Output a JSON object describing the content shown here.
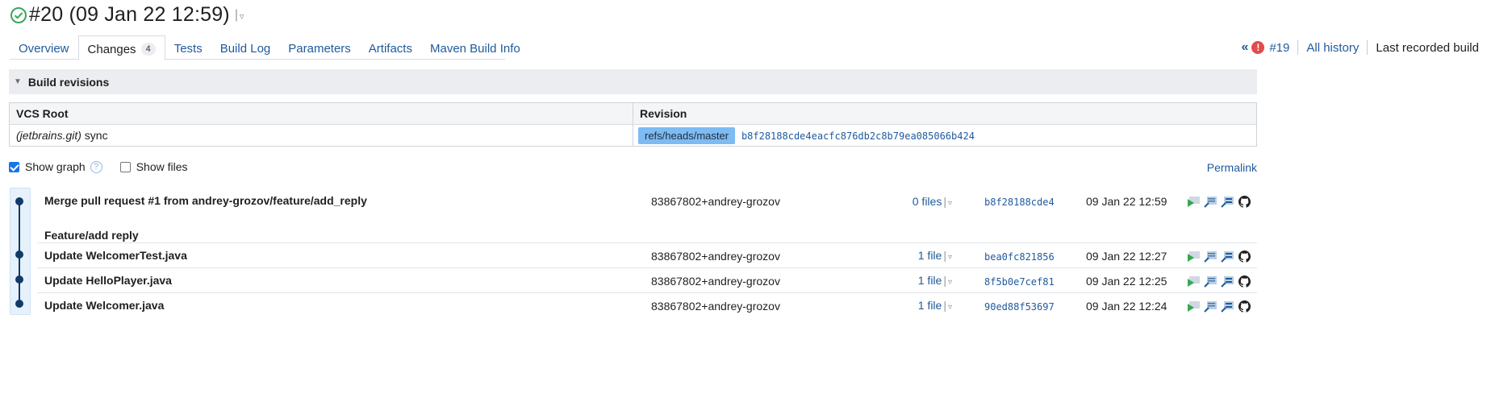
{
  "build": {
    "title": "#20 (09 Jan 22 12:59)",
    "separator": "|",
    "caret": "▿",
    "status_icon": "success-check-icon",
    "status_color": "#3aa65b"
  },
  "tabs": [
    {
      "label": "Overview"
    },
    {
      "label": "Changes",
      "count": "4",
      "active": true
    },
    {
      "label": "Tests"
    },
    {
      "label": "Build Log"
    },
    {
      "label": "Parameters"
    },
    {
      "label": "Artifacts"
    },
    {
      "label": "Maven Build Info"
    }
  ],
  "nav": {
    "prev_icon": "«",
    "prev_status_icon": "!",
    "prev_build": "#19",
    "all_history": "All history",
    "last_recorded": "Last recorded build"
  },
  "revisions": {
    "section_title": "Build revisions",
    "col_vcs": "VCS Root",
    "col_revision": "Revision",
    "vcs_root_name": "(jetbrains.git)",
    "vcs_root_suffix": " sync",
    "branch": "refs/heads/master",
    "revision_hash": "b8f28188cde4eacfc876db2c8b79ea085066b424"
  },
  "options": {
    "show_graph_label": "Show graph",
    "show_graph_checked": true,
    "help_icon": "?",
    "show_files_label": "Show files",
    "show_files_checked": false,
    "permalink": "Permalink"
  },
  "changes": [
    {
      "message": "Merge pull request #1 from andrey-grozov/feature/add_reply",
      "message2": "Feature/add reply",
      "author": "83867802+andrey-grozov",
      "files": "0 files",
      "hash": "b8f28188cde4",
      "date": "09 Jan 22 12:59"
    },
    {
      "message": "Update WelcomerTest.java",
      "author": "83867802+andrey-grozov",
      "files": "1 file",
      "hash": "bea0fc821856",
      "date": "09 Jan 22 12:27"
    },
    {
      "message": "Update HelloPlayer.java",
      "author": "83867802+andrey-grozov",
      "files": "1 file",
      "hash": "8f5b0e7cef81",
      "date": "09 Jan 22 12:25"
    },
    {
      "message": "Update Welcomer.java",
      "author": "83867802+andrey-grozov",
      "files": "1 file",
      "hash": "90ed88f53697",
      "date": "09 Jan 22 12:24"
    }
  ],
  "files_separator": "|",
  "files_caret": "▿",
  "action_icons": [
    "run-build-icon",
    "compare-changes-icon",
    "download-patch-icon",
    "github-icon"
  ]
}
